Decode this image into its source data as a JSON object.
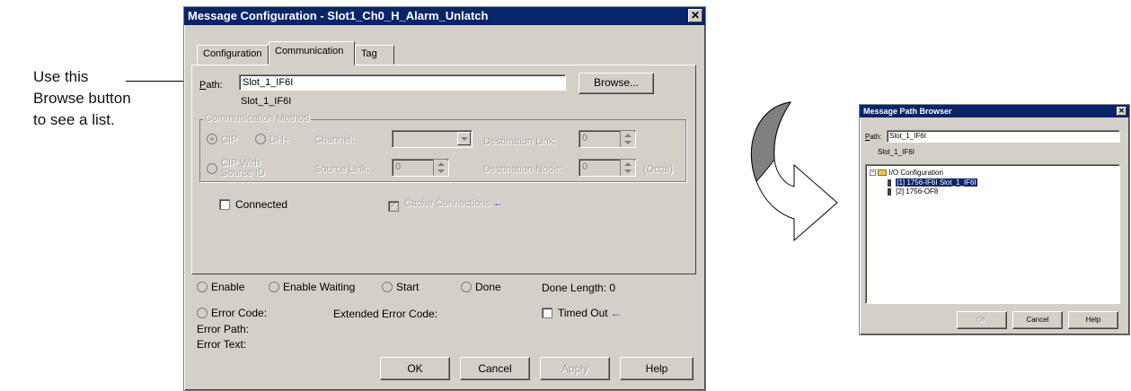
{
  "callout": {
    "lines": "Use this\nBrowse button\nto see a list."
  },
  "message_dialog": {
    "title": "Message Configuration - Slot1_Ch0_H_Alarm_Unlatch",
    "close_glyph": "✕",
    "tabs": [
      "Configuration",
      "Communication",
      "Tag"
    ],
    "active_tab": "Communication",
    "path_label": "Path:",
    "path_value": "Slot_1_IF6I",
    "path_resolved": "Slot_1_IF6I",
    "browse_label": "Browse...",
    "comm_method_legend": "Communication Method",
    "cip_label": "CIP",
    "dhplus_label": "DH+",
    "channel_label": "Channel:",
    "dest_link_label": "Destination Link:",
    "dest_link_value": "0",
    "cip_source_label_1": "CIP With",
    "cip_source_label_2": "Source ID",
    "source_link_label": "Source Link:",
    "source_link_value": "0",
    "dest_node_label": "Destination Node:",
    "dest_node_value": "0",
    "octal_label": "(Octal)",
    "connected_label": "Connected",
    "cache_label": "Cache Connections",
    "blue_arrow": "←",
    "status": {
      "enable": "Enable",
      "enable_waiting": "Enable Waiting",
      "start": "Start",
      "done": "Done",
      "done_length": "Done Length: 0",
      "error_code": "Error Code:",
      "extended_error_code": "Extended Error Code:",
      "timed_out": "Timed Out",
      "error_path": "Error Path:",
      "error_text": "Error Text:"
    },
    "buttons": {
      "ok": "OK",
      "cancel": "Cancel",
      "apply": "Apply",
      "help": "Help"
    }
  },
  "path_browser": {
    "title": "Message Path Browser",
    "close_glyph": "✕",
    "path_label": "Path:",
    "path_value": "Slot_1_IF6I",
    "path_resolved": "Slot_1_IF6I",
    "tree": {
      "root": "I/O Configuration",
      "items": [
        "[1] 1756-IF6I Slot_1_IF6I",
        "[2] 1756-OF8"
      ],
      "selected_index": 0
    },
    "buttons": {
      "ok": "OK",
      "cancel": "Cancel",
      "help": "Help"
    }
  },
  "colors": {
    "titlebar": "#0a246a",
    "dialog_face": "#d4d0c8",
    "selection": "#0a246a",
    "arrow_accent": "#1a33c8"
  }
}
